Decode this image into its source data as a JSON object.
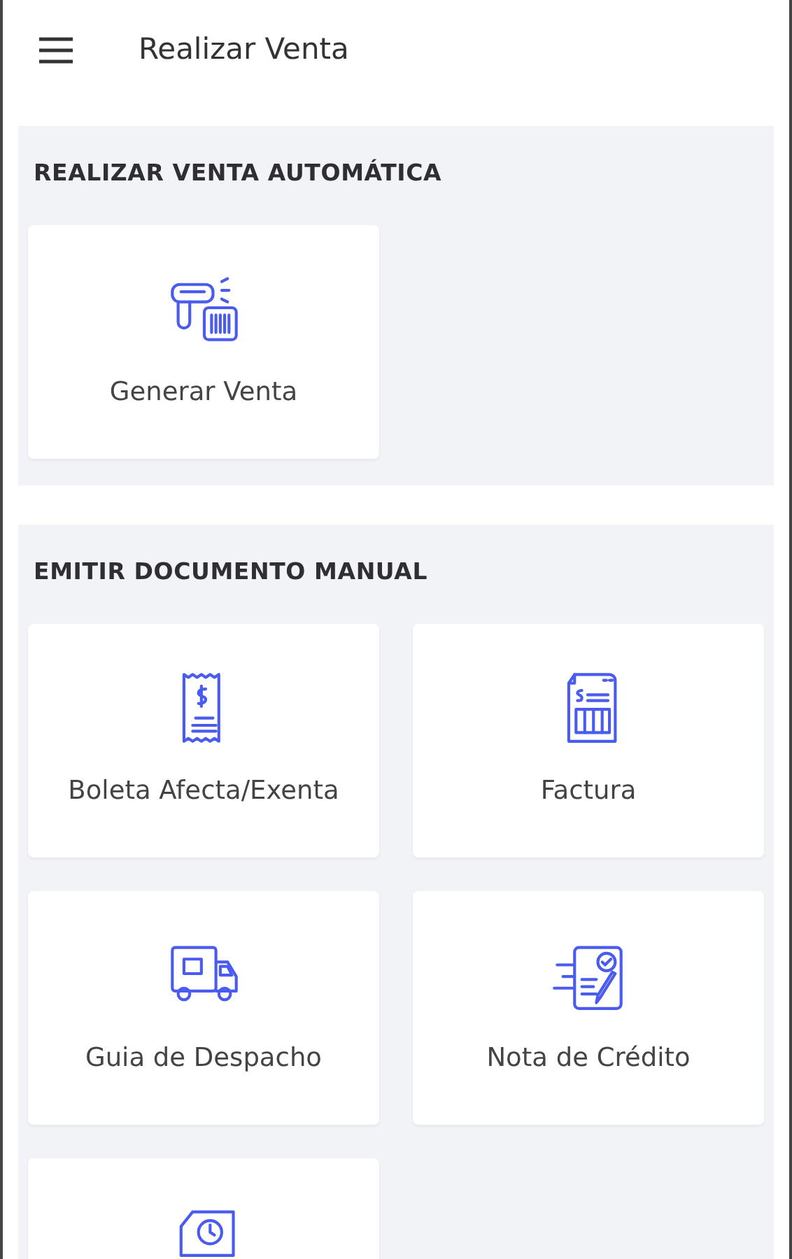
{
  "app_bar": {
    "title": "Realizar Venta"
  },
  "sections": [
    {
      "title": "REALIZAR VENTA AUTOMÁTICA",
      "tiles": [
        {
          "kind": "scanner",
          "label": "Generar Venta"
        }
      ]
    },
    {
      "title": "EMITIR DOCUMENTO MANUAL",
      "tiles": [
        {
          "kind": "receipt",
          "label": "Boleta Afecta/Exenta"
        },
        {
          "kind": "invoice",
          "label": "Factura"
        },
        {
          "kind": "truck",
          "label": "Guia de Despacho"
        },
        {
          "kind": "credit",
          "label": "Nota de Crédito"
        },
        {
          "kind": "cash"
        }
      ]
    }
  ]
}
